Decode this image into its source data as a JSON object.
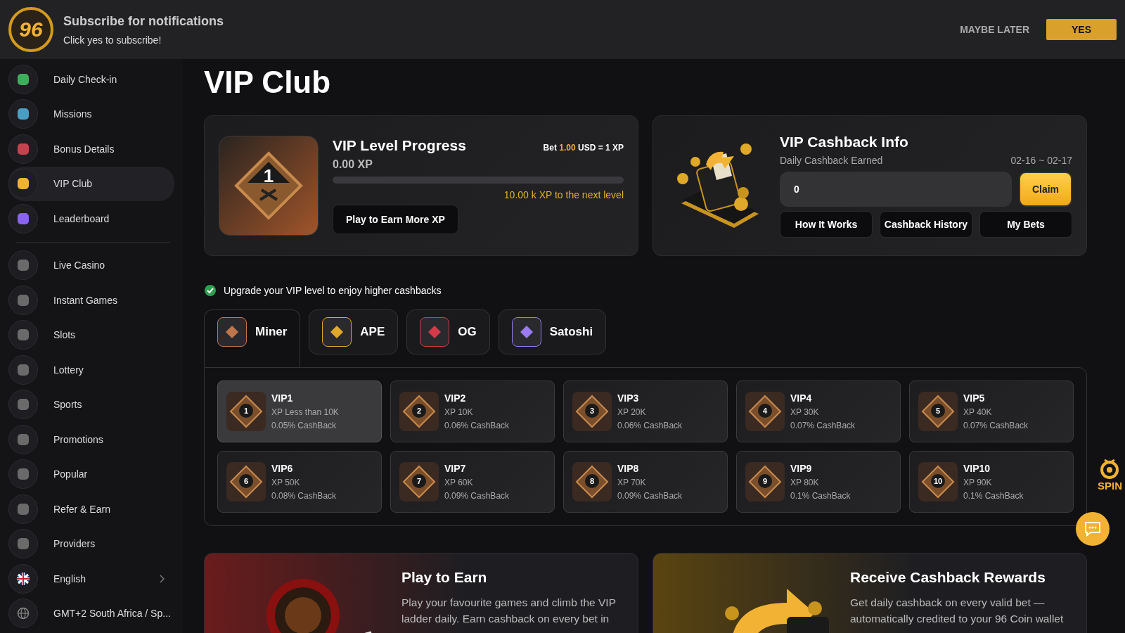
{
  "banner": {
    "logo_text": "96",
    "title": "Subscribe for notifications",
    "subtitle": "Click yes to subscribe!",
    "buttons": [
      {
        "label": "MAYBE LATER",
        "kind": "text"
      },
      {
        "label": "YES",
        "kind": "primary"
      }
    ]
  },
  "sidebar": {
    "groups": [
      {
        "items": [
          {
            "label": "Daily Check-in",
            "color": "#3fae5a",
            "selected": false
          },
          {
            "label": "Missions",
            "color": "#4a9ec4",
            "selected": false
          },
          {
            "label": "Bonus Details",
            "color": "#c4434f",
            "selected": false
          },
          {
            "label": "VIP Club",
            "color": "#f2b233",
            "selected": true
          },
          {
            "label": "Leaderboard",
            "color": "#8a63f0",
            "selected": false
          }
        ]
      },
      {
        "items": [
          {
            "label": "Live Casino",
            "color": "#6a6a6a",
            "selected": false
          },
          {
            "label": "Instant Games",
            "color": "#6a6a6a",
            "selected": false
          },
          {
            "label": "Slots",
            "color": "#6a6a6a",
            "selected": false
          },
          {
            "label": "Lottery",
            "color": "#6a6a6a",
            "selected": false
          },
          {
            "label": "Sports",
            "color": "#6a6a6a",
            "selected": false
          },
          {
            "label": "Promotions",
            "color": "#6a6a6a",
            "selected": false
          },
          {
            "label": "Popular",
            "color": "#6a6a6a",
            "selected": false
          },
          {
            "label": "Refer & Earn",
            "color": "#6a6a6a",
            "selected": false
          },
          {
            "label": "Providers",
            "color": "#6a6a6a",
            "selected": false
          }
        ]
      }
    ],
    "footer": [
      {
        "label": "English",
        "kind": "language"
      },
      {
        "label": "GMT+2 South Africa / Sp...",
        "kind": "timezone"
      }
    ]
  },
  "page_title": "VIP Club",
  "progress": {
    "badge_number": "1",
    "title": "VIP Level Progress",
    "rate_prefix": "Bet",
    "rate_amount": "1.00",
    "rate_suffix": "USD = 1 XP",
    "xp": "0.00 XP",
    "level": 0,
    "next_level": "10.00 k XP to the next level",
    "button": "Play to Earn More XP"
  },
  "cashback": {
    "title": "VIP Cashback Info",
    "label": "Daily Cashback Earned",
    "period": "02-16 ~ 02-17",
    "value": "0",
    "claim": "Claim",
    "buttons": [
      "How It Works",
      "Cashback History",
      "My Bets"
    ]
  },
  "notice": "Upgrade your VIP level to enjoy higher cashbacks",
  "tabs": [
    {
      "label": "Miner",
      "color": "#c0764a",
      "selected": true
    },
    {
      "label": "APE",
      "color": "#e0a82a",
      "selected": false
    },
    {
      "label": "OG",
      "color": "#d43a48",
      "selected": false
    },
    {
      "label": "Satoshi",
      "color": "#9a7cf0",
      "selected": false
    }
  ],
  "levels": [
    {
      "number": "1",
      "name": "VIP1",
      "xp": "XP Less than 10K",
      "cashback": "0.05% CashBack",
      "selected": true
    },
    {
      "number": "2",
      "name": "VIP2",
      "xp": "XP 10K",
      "cashback": "0.06% CashBack",
      "selected": false
    },
    {
      "number": "3",
      "name": "VIP3",
      "xp": "XP 20K",
      "cashback": "0.06% CashBack",
      "selected": false
    },
    {
      "number": "4",
      "name": "VIP4",
      "xp": "XP 30K",
      "cashback": "0.07% CashBack",
      "selected": false
    },
    {
      "number": "5",
      "name": "VIP5",
      "xp": "XP 40K",
      "cashback": "0.07% CashBack",
      "selected": false
    },
    {
      "number": "6",
      "name": "VIP6",
      "xp": "XP 50K",
      "cashback": "0.08% CashBack",
      "selected": false
    },
    {
      "number": "7",
      "name": "VIP7",
      "xp": "XP 60K",
      "cashback": "0.09% CashBack",
      "selected": false
    },
    {
      "number": "8",
      "name": "VIP8",
      "xp": "XP 70K",
      "cashback": "0.09% CashBack",
      "selected": false
    },
    {
      "number": "9",
      "name": "VIP9",
      "xp": "XP 80K",
      "cashback": "0.1% CashBack",
      "selected": false
    },
    {
      "number": "10",
      "name": "VIP10",
      "xp": "XP 90K",
      "cashback": "0.1% CashBack",
      "selected": false
    }
  ],
  "promos": [
    {
      "kind": "roulette",
      "title": "Play to Earn",
      "text": "Play your favourite games and climb the VIP ladder daily. Earn cashback on every bet in"
    },
    {
      "kind": "cashback",
      "title": "Receive Cashback Rewards",
      "text": "Get daily cashback on every valid bet — automatically credited to your 96 Coin wallet"
    }
  ],
  "spin": "SPIN"
}
